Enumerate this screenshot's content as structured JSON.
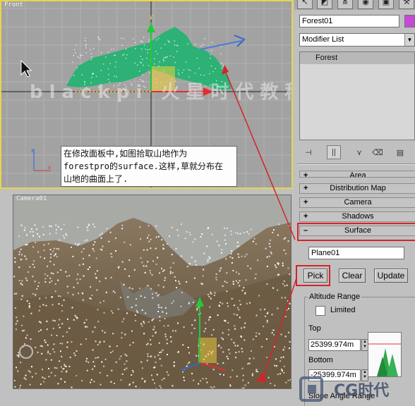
{
  "front_viewport": {
    "label": "Front"
  },
  "camera_viewport": {
    "label": "Camera01"
  },
  "watermark": "blackpi 火星时代教程",
  "callout": {
    "lines": [
      "在修改面板中,如图拾取山地作为",
      "forestpro的surface.这样,草就分布在",
      "山地的曲面上了."
    ]
  },
  "panel": {
    "tab_icons": [
      "cursor-icon",
      "hierarchy-icon",
      "motion-icon",
      "display-icon",
      "utilities-icon"
    ],
    "object_name": "Forest01",
    "object_color": "#c848d8",
    "modifier_list": "Modifier List",
    "stack_items": [
      "Forest"
    ],
    "rollouts": [
      "Area",
      "Distribution Map",
      "Camera",
      "Shadows",
      "Surface"
    ],
    "rollout_signs": [
      "+",
      "+",
      "+",
      "+",
      "–"
    ],
    "surface": {
      "object_field": "Plane01",
      "pick_label": "Pick",
      "clear_label": "Clear",
      "update_label": "Update",
      "altitude_title": "Altitude Range",
      "limited_label": "Limited",
      "top_label": "Top",
      "top_value": "25399.974m",
      "bottom_label": "Bottom",
      "bottom_value": "-25399.974m",
      "slope_label": "Slope Angle Range"
    }
  },
  "logo_text": "CG时代",
  "colors": {
    "highlight_red": "#d4242b",
    "active_viewport_border": "#e7d54a",
    "vegetation_green": "#1db56f",
    "object_color": "#c848d8"
  }
}
